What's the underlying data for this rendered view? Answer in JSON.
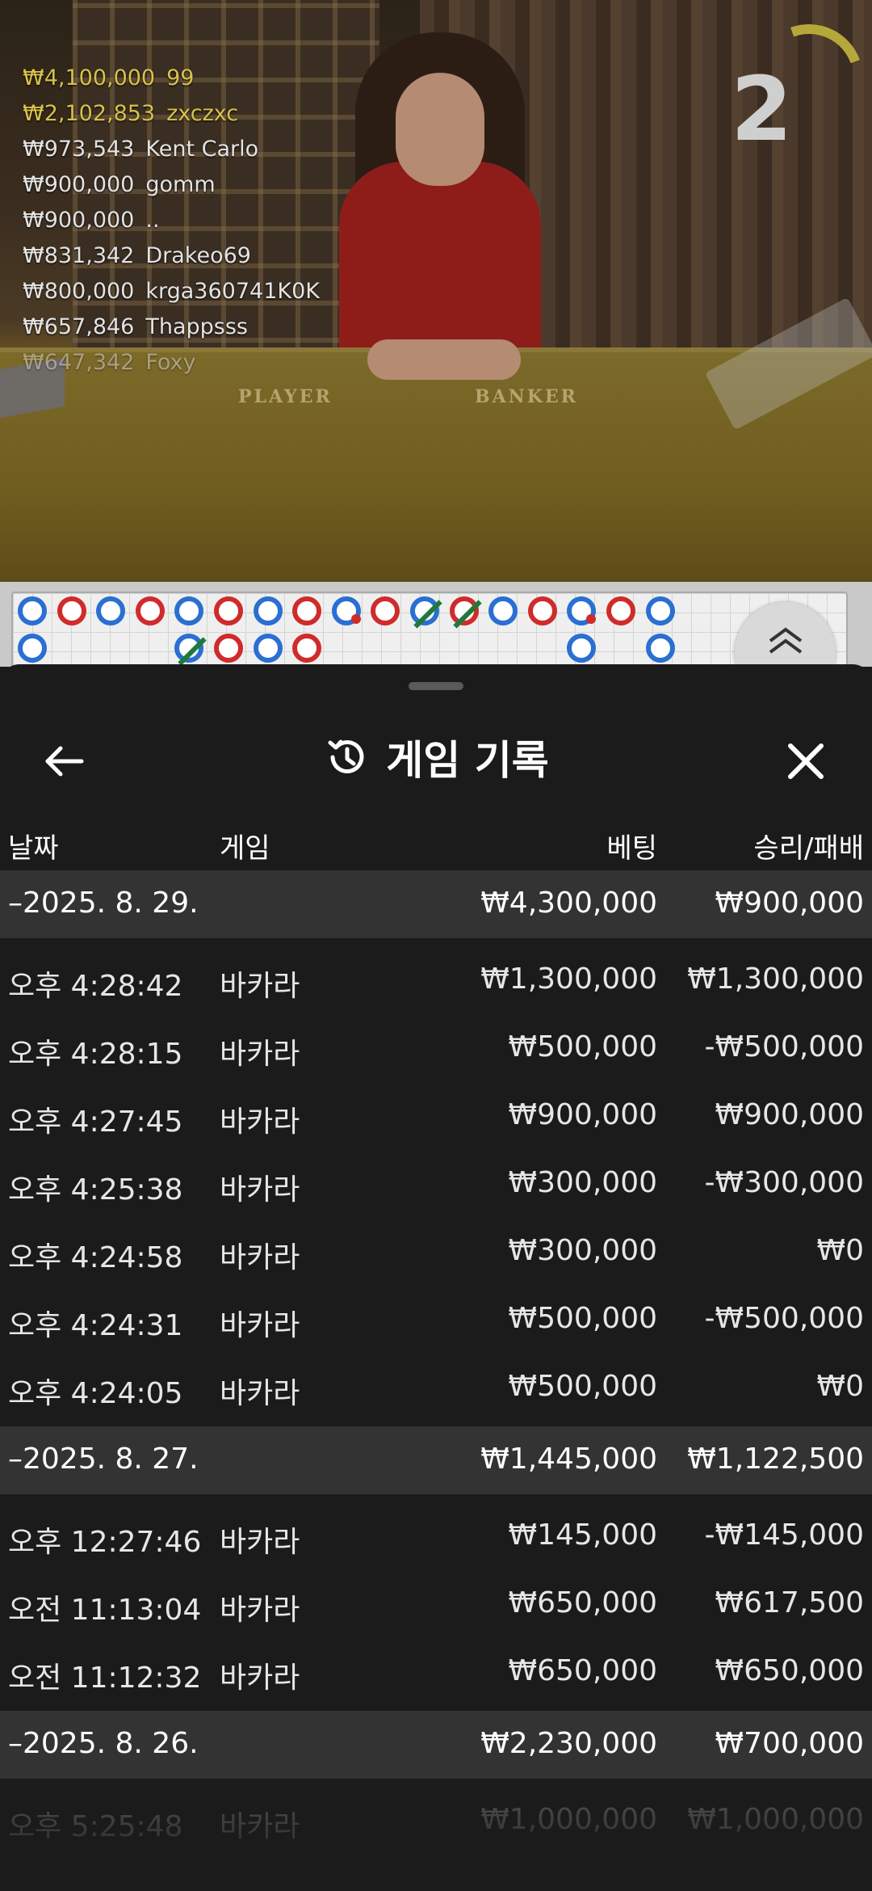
{
  "video": {
    "timer": "2",
    "felt_player": "PLAYER",
    "felt_banker": "BANKER",
    "bets": [
      {
        "amount": "₩4,100,000",
        "name": "99",
        "style": "gold"
      },
      {
        "amount": "₩2,102,853",
        "name": "zxczxc",
        "style": "gold"
      },
      {
        "amount": "₩973,543",
        "name": "Kent Carlo",
        "style": "normal"
      },
      {
        "amount": "₩900,000",
        "name": "gomm",
        "style": "normal"
      },
      {
        "amount": "₩900,000",
        "name": "..",
        "style": "normal"
      },
      {
        "amount": "₩831,342",
        "name": "Drakeo69",
        "style": "normal"
      },
      {
        "amount": "₩800,000",
        "name": "krga360741K0K",
        "style": "normal"
      },
      {
        "amount": "₩657,846",
        "name": "Thappsss",
        "style": "normal"
      },
      {
        "amount": "₩647,342",
        "name": "Foxy",
        "style": "fade"
      }
    ]
  },
  "roadmap": {
    "colors": {
      "player": "#2a6fd1",
      "banker": "#d02b2b",
      "tie": "#1f7a3a"
    },
    "row1": [
      "P",
      "B",
      "P",
      "B",
      "P",
      "B",
      "P",
      "B",
      "Pd",
      "B",
      "Pt",
      "Bt",
      "P",
      "B",
      "Pd",
      "B",
      "P"
    ],
    "row2": [
      "P",
      "",
      "",
      "",
      "Pt",
      "B",
      "P",
      "B",
      "",
      "",
      "",
      "",
      "",
      "",
      "P",
      "",
      "P"
    ]
  },
  "sheet": {
    "title": "게임 기록",
    "icons": {
      "back": "back-arrow-icon",
      "history": "history-icon",
      "close": "close-icon"
    },
    "columns": {
      "date": "날짜",
      "game": "게임",
      "bet": "베팅",
      "result": "승리/패배"
    },
    "groups": [
      {
        "date": "–2025. 8. 29.",
        "bet_total": "₩4,300,000",
        "result_total": "₩900,000",
        "rows": [
          {
            "time": "오후 4:28:42",
            "game": "바카라",
            "bet": "₩1,300,000",
            "result": "₩1,300,000"
          },
          {
            "time": "오후 4:28:15",
            "game": "바카라",
            "bet": "₩500,000",
            "result": "-₩500,000"
          },
          {
            "time": "오후 4:27:45",
            "game": "바카라",
            "bet": "₩900,000",
            "result": "₩900,000"
          },
          {
            "time": "오후 4:25:38",
            "game": "바카라",
            "bet": "₩300,000",
            "result": "-₩300,000"
          },
          {
            "time": "오후 4:24:58",
            "game": "바카라",
            "bet": "₩300,000",
            "result": "₩0"
          },
          {
            "time": "오후 4:24:31",
            "game": "바카라",
            "bet": "₩500,000",
            "result": "-₩500,000"
          },
          {
            "time": "오후 4:24:05",
            "game": "바카라",
            "bet": "₩500,000",
            "result": "₩0"
          }
        ]
      },
      {
        "date": "–2025. 8. 27.",
        "bet_total": "₩1,445,000",
        "result_total": "₩1,122,500",
        "rows": [
          {
            "time": "오후 12:27:46",
            "game": "바카라",
            "bet": "₩145,000",
            "result": "-₩145,000"
          },
          {
            "time": "오전 11:13:04",
            "game": "바카라",
            "bet": "₩650,000",
            "result": "₩617,500"
          },
          {
            "time": "오전 11:12:32",
            "game": "바카라",
            "bet": "₩650,000",
            "result": "₩650,000"
          }
        ]
      },
      {
        "date": "–2025. 8. 26.",
        "bet_total": "₩2,230,000",
        "result_total": "₩700,000",
        "rows": [
          {
            "time": "오후 5:25:48",
            "game": "바카라",
            "bet": "₩1,000,000",
            "result": "₩1,000,000",
            "style": "fade"
          }
        ]
      }
    ]
  }
}
